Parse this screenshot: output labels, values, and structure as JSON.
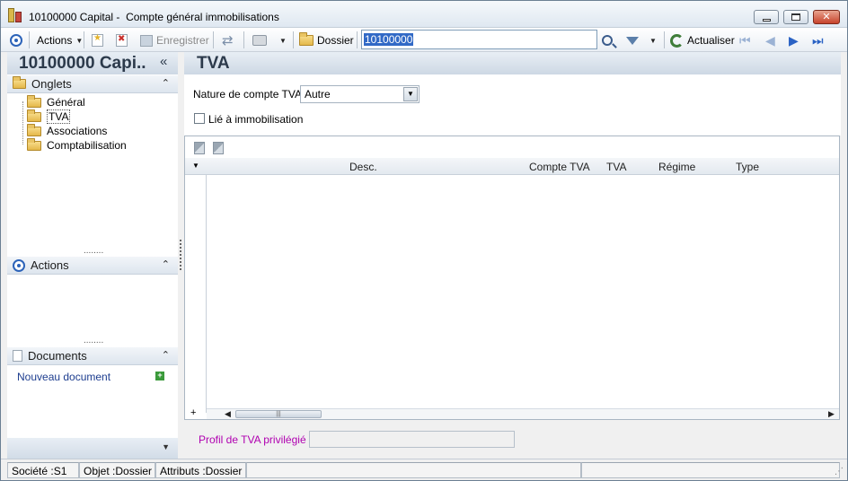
{
  "window": {
    "title": "10100000 Capital -  Compte général immobilisations",
    "minimize_icon": "minimize-icon",
    "maximize_icon": "maximize-icon",
    "close_icon": "close-icon"
  },
  "toolbar": {
    "actions_label": "Actions",
    "save_label": "Enregistrer",
    "folder_label": "Dossier",
    "search_value": "10100000",
    "refresh_label": "Actualiser"
  },
  "left": {
    "title": "10100000 Capi..",
    "collapse_glyph": "«",
    "onglets_label": "Onglets",
    "tree": [
      "Général",
      "TVA",
      "Associations",
      "Comptabilisation"
    ],
    "actions_label": "Actions",
    "documents_label": "Documents",
    "new_document": "Nouveau document"
  },
  "right": {
    "title": "TVA",
    "nature_label": "Nature de compte TVA :",
    "nature_value": "Autre",
    "lie_label": "Lié à immobilisation",
    "columns": [
      "Desc.",
      "Compte TVA",
      "TVA",
      "Régime",
      "Type"
    ],
    "profile_label": "Profil de TVA privilégié :"
  },
  "statusbar": {
    "societe": "Société :S1",
    "objet": "Objet :Dossier",
    "attributs": "Attributs :Dossier"
  },
  "colors": {
    "accent": "#2c63b9",
    "profile_label": "#b000b0",
    "link": "#1d3d8f"
  }
}
